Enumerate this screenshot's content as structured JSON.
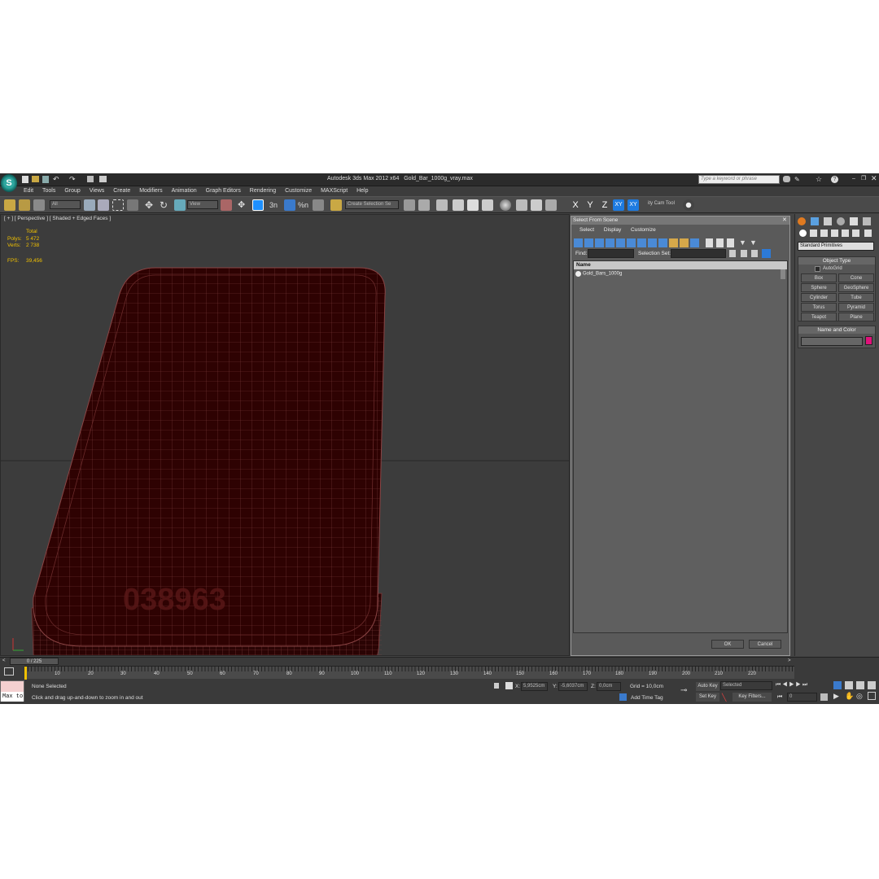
{
  "title": {
    "app": "Autodesk 3ds Max  2012 x64",
    "file": "Gold_Bar_1000g_vray.max",
    "search_placeholder": "Type a keyword or phrase"
  },
  "menu": [
    "Edit",
    "Tools",
    "Group",
    "Views",
    "Create",
    "Modifiers",
    "Animation",
    "Graph Editors",
    "Rendering",
    "Customize",
    "MAXScript",
    "Help"
  ],
  "toolbar": {
    "filter": "All",
    "view": "View",
    "selection_set": "Create Selection Se",
    "axes": [
      "X",
      "Y",
      "Z",
      "XY",
      "XY"
    ],
    "cam_tool": "ity Cam Tool"
  },
  "viewport": {
    "label": "[ + ] [ Perspective ] [ Shaded + Edged Faces ]",
    "stats_total": "Total",
    "polys_label": "Polys:",
    "polys": "5 472",
    "verts_label": "Verts:",
    "verts": "2 738",
    "fps_label": "FPS:",
    "fps": "39,456",
    "engraving": "038963"
  },
  "dialog": {
    "title": "Select From Scene",
    "menu": [
      "Select",
      "Display",
      "Customize"
    ],
    "find_label": "Find:",
    "selset_label": "Selection Set:",
    "column": "Name",
    "item": "Gold_Bars_1000g",
    "ok": "OK",
    "cancel": "Cancel"
  },
  "cmd": {
    "dropdown": "Standard Primitives",
    "object_type": "Object Type",
    "autogrid": "AutoGrid",
    "prims": [
      "Box",
      "Cone",
      "Sphere",
      "GeoSphere",
      "Cylinder",
      "Tube",
      "Torus",
      "Pyramid",
      "Teapot",
      "Plane"
    ],
    "name_color": "Name and Color",
    "swatch": "#e0127a"
  },
  "timeline": {
    "frame": "0 / 225",
    "ticks": [
      "10",
      "20",
      "30",
      "40",
      "50",
      "60",
      "70",
      "80",
      "90",
      "100",
      "110",
      "120",
      "130",
      "140",
      "150",
      "160",
      "170",
      "180",
      "190",
      "200",
      "210",
      "220"
    ]
  },
  "status": {
    "maxscript": "Max to",
    "selected": "None Selected",
    "prompt": "Click and drag up-and-down to zoom in and out",
    "x_label": "X:",
    "x": "5,9525cm",
    "y_label": "Y:",
    "y": "-5,6037cm",
    "z_label": "Z:",
    "z": "0,0cm",
    "grid": "Grid = 10,0cm",
    "add_time_tag": "Add Time Tag",
    "auto_key": "Auto Key",
    "selected_dd": "Selected",
    "set_key": "Set Key",
    "key_filters": "Key Filters...",
    "frame_field": "0"
  }
}
